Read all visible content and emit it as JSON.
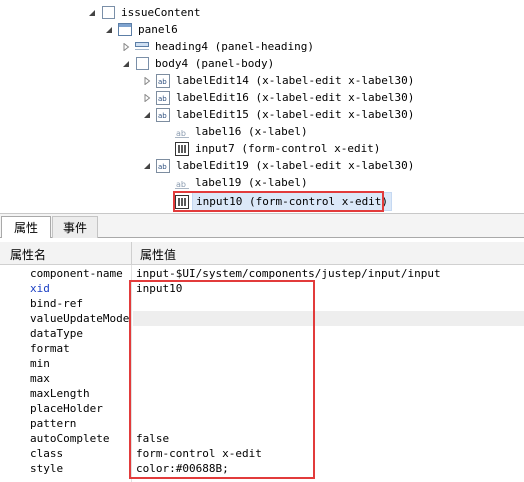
{
  "tree": {
    "nodes": [
      {
        "label": "issueContent",
        "icon": "box-icon",
        "toggle": "expanded"
      },
      {
        "label": "panel6",
        "icon": "panel-icon",
        "toggle": "expanded"
      },
      {
        "label": "heading4 (panel-heading)",
        "icon": "heading-icon",
        "toggle": "collapsed"
      },
      {
        "label": "body4 (panel-body)",
        "icon": "box-icon",
        "toggle": "expanded"
      },
      {
        "label": "labelEdit14 (x-label-edit x-label30)",
        "icon": "label-edit-icon",
        "toggle": "collapsed"
      },
      {
        "label": "labelEdit16 (x-label-edit x-label30)",
        "icon": "label-edit-icon",
        "toggle": "collapsed"
      },
      {
        "label": "labelEdit15 (x-label-edit x-label30)",
        "icon": "label-edit-icon",
        "toggle": "expanded"
      },
      {
        "label": "label16 (x-label)",
        "icon": "label-icon",
        "toggle": "none"
      },
      {
        "label": "input7 (form-control x-edit)",
        "icon": "input-icon",
        "toggle": "none"
      },
      {
        "label": "labelEdit19 (x-label-edit x-label30)",
        "icon": "label-edit-icon",
        "toggle": "expanded"
      },
      {
        "label": "label19 (x-label)",
        "icon": "label-icon",
        "toggle": "none"
      },
      {
        "label": "input10 (form-control x-edit)",
        "icon": "input-icon",
        "toggle": "none",
        "selected": true
      }
    ]
  },
  "tabs": [
    {
      "label": "属性",
      "active": true
    },
    {
      "label": "事件",
      "active": false
    }
  ],
  "properties": {
    "header_name": "属性名",
    "header_value": "属性值",
    "rows": [
      {
        "name": "component-name",
        "value": "input-$UI/system/components/justep/input/input",
        "readonly": false
      },
      {
        "name": "xid",
        "value": "input10",
        "accent": true
      },
      {
        "name": "bind-ref",
        "value": ""
      },
      {
        "name": "valueUpdateMode",
        "value": "",
        "readonly": true
      },
      {
        "name": "dataType",
        "value": ""
      },
      {
        "name": "format",
        "value": ""
      },
      {
        "name": "min",
        "value": ""
      },
      {
        "name": "max",
        "value": ""
      },
      {
        "name": "maxLength",
        "value": ""
      },
      {
        "name": "placeHolder",
        "value": ""
      },
      {
        "name": "pattern",
        "value": ""
      },
      {
        "name": "autoComplete",
        "value": "false"
      },
      {
        "name": "class",
        "value": "form-control x-edit"
      },
      {
        "name": "style",
        "value": "color:#00688B;"
      }
    ]
  },
  "colors": {
    "highlight": "#e23b3b",
    "xid_name": "#1a3fc4",
    "selection": "#dbe8f8"
  }
}
